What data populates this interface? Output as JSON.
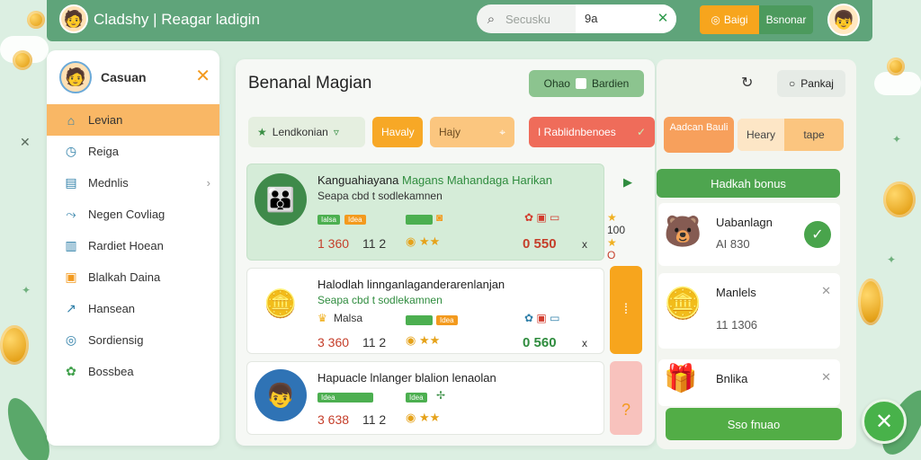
{
  "header": {
    "app_title": "Cladshy | Reagar ladigin",
    "search": {
      "placeholder": "Secusku",
      "value": "9a"
    },
    "btn_a_label": "Baigi",
    "btn_b_label": "Bsnonar"
  },
  "sidebar": {
    "user_name": "Casuan",
    "items": [
      {
        "label": "Levian",
        "icon": "home-icon",
        "active": true
      },
      {
        "label": "Reiga",
        "icon": "clock-icon"
      },
      {
        "label": "Mednlis",
        "icon": "document-icon",
        "chevron": true
      },
      {
        "label": "Negen Covliag",
        "icon": "share-icon"
      },
      {
        "label": "Rardiet Hoean",
        "icon": "chart-icon"
      },
      {
        "label": "Blalkah Daina",
        "icon": "wallet-icon"
      },
      {
        "label": "Hansean",
        "icon": "external-icon"
      },
      {
        "label": "Sordiensig",
        "icon": "settings-icon"
      },
      {
        "label": "Bossbea",
        "icon": "leaf-icon"
      }
    ]
  },
  "main": {
    "title": "Benanal Magian",
    "toggle_label": "Ohao",
    "toggle_value": "Bardien",
    "filters": {
      "chip1": "Lendkonian",
      "chip2": "Havaly",
      "chip3": "Hajy",
      "chip4": "I Rablidnbenoes"
    },
    "cards": [
      {
        "title_a": "Kanguahiayana ",
        "title_b": "Magans Mahandaga Harikan",
        "subtitle": "Seapa cbd t sodlekamnen",
        "tag1": "Ialsa",
        "tag2": "Idea",
        "num1": "1 360",
        "num2": "11 2",
        "score": "0 550",
        "mini": "100",
        "mini2": "x"
      },
      {
        "title_a": "Halodlah linnganlaganderarenlanjan",
        "title_b": "",
        "subtitle": "Seapa cbd t sodlekamnen",
        "tag1": "Malsa",
        "tag2": "Idea",
        "num1": "3 360",
        "num2": "11 2",
        "score": "0 560",
        "mini": "x"
      },
      {
        "title_a": "Hapuacle lnlanger blalion lenaolan",
        "title_b": "",
        "subtitle": "",
        "tag1": "Idea",
        "tag2": "Idea",
        "num1": "3 638",
        "num2": "11 2"
      }
    ]
  },
  "right": {
    "btn_label": "Pankaj",
    "chip1": "Aadcan Bauli",
    "chip2a": "Heary",
    "chip2b": "tape",
    "bonus_label": "Hadkah bonus",
    "items": [
      {
        "name": "Uabanlagn",
        "value": "AI 830"
      },
      {
        "name": "Manlels",
        "value": "11 1306"
      },
      {
        "name": "Bnlika",
        "value": ""
      }
    ],
    "action_label": "Sso fnuao"
  },
  "colors": {
    "brand_green": "#5fa47a",
    "accent_orange": "#f7a51d",
    "danger_red": "#ef6c5a",
    "success_green": "#4ea54f"
  }
}
